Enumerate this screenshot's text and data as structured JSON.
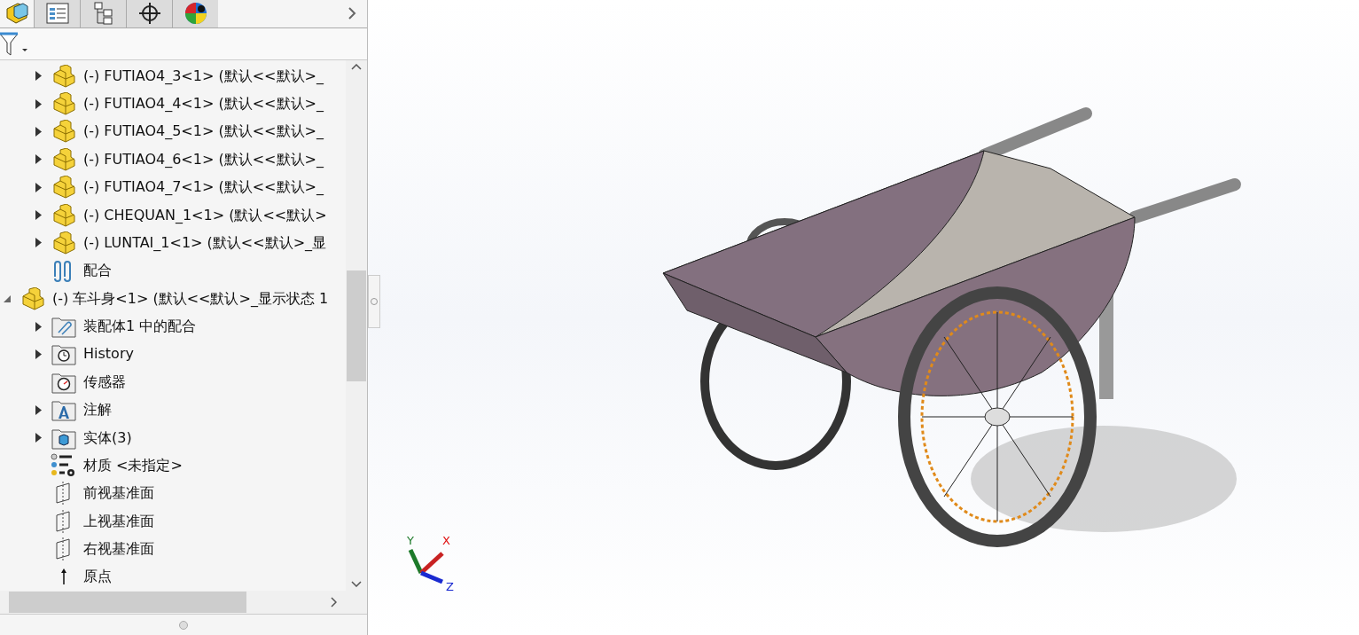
{
  "tabs": [
    {
      "kind": "feature-tree",
      "selected": true
    },
    {
      "kind": "property",
      "selected": false
    },
    {
      "kind": "config",
      "selected": false
    },
    {
      "kind": "dimxpert",
      "selected": false
    },
    {
      "kind": "display",
      "selected": false
    }
  ],
  "tree": [
    {
      "children": [
        {
          "kind": "part",
          "label": "(-) FUTIAO4_3<1> (默认<<默认>_",
          "expanded": false
        },
        {
          "kind": "part",
          "label": "(-) FUTIAO4_4<1> (默认<<默认>_",
          "expanded": false
        },
        {
          "kind": "part",
          "label": "(-) FUTIAO4_5<1> (默认<<默认>_",
          "expanded": false
        },
        {
          "kind": "part",
          "label": "(-) FUTIAO4_6<1> (默认<<默认>_",
          "expanded": false
        },
        {
          "kind": "part",
          "label": "(-) FUTIAO4_7<1> (默认<<默认>_",
          "expanded": false
        },
        {
          "kind": "part",
          "label": "(-) CHEQUAN_1<1> (默认<<默认>",
          "expanded": false
        },
        {
          "kind": "part",
          "label": "(-) LUNTAI_1<1> (默认<<默认>_显",
          "expanded": false
        },
        {
          "kind": "mates",
          "label": "配合"
        }
      ]
    },
    {
      "kind": "part",
      "label": "(-) 车斗身<1> (默认<<默认>_显示状态 1",
      "expanded": true,
      "children": [
        {
          "kind": "mates-folder",
          "label": "装配体1 中的配合",
          "expanded": false
        },
        {
          "kind": "history",
          "label": "History",
          "expanded": false
        },
        {
          "kind": "sensors",
          "label": "传感器"
        },
        {
          "kind": "annotations",
          "label": "注解",
          "expanded": false
        },
        {
          "kind": "solids",
          "label": "实体(3)",
          "expanded": false
        },
        {
          "kind": "material",
          "label": "材质 <未指定>"
        },
        {
          "kind": "plane",
          "label": "前视基准面"
        },
        {
          "kind": "plane",
          "label": "上视基准面"
        },
        {
          "kind": "plane",
          "label": "右视基准面"
        },
        {
          "kind": "origin",
          "label": "原点"
        }
      ]
    }
  ],
  "triad": {
    "x": "X",
    "y": "Y",
    "z": "Z"
  }
}
